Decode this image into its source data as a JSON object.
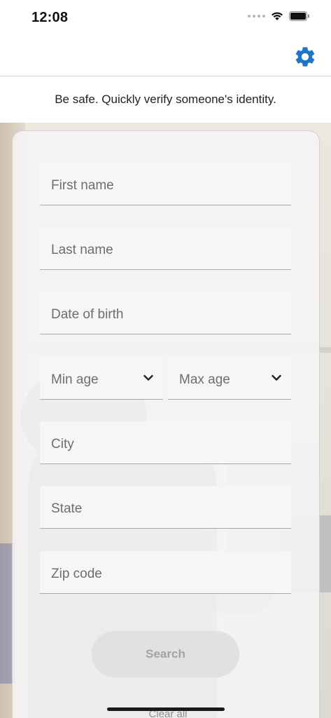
{
  "status_bar": {
    "time": "12:08"
  },
  "nav": {
    "settings_icon": "gear-icon"
  },
  "tagline": "Be safe. Quickly verify someone's identity.",
  "form": {
    "first_name": "First name",
    "last_name": "Last name",
    "date_of_birth": "Date of birth",
    "min_age": "Min age",
    "max_age": "Max age",
    "city": "City",
    "state": "State",
    "zip_code": "Zip code"
  },
  "actions": {
    "search_label": "Search",
    "clear_all_label": "Clear all"
  },
  "colors": {
    "accent": "#1E74C9",
    "field_bg": "#F6F6F6",
    "label_text": "#6E6E6E",
    "button_disabled_text": "#A2A2A2"
  }
}
